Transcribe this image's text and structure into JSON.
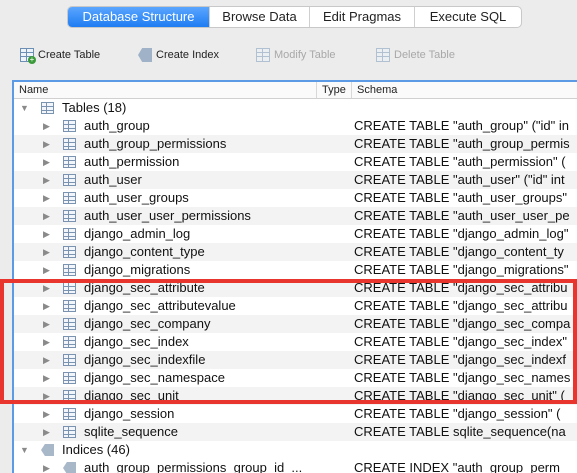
{
  "tabs": [
    {
      "label": "Database Structure",
      "active": true
    },
    {
      "label": "Browse Data",
      "active": false
    },
    {
      "label": "Edit Pragmas",
      "active": false
    },
    {
      "label": "Execute SQL",
      "active": false
    }
  ],
  "toolbar": {
    "create_table": "Create Table",
    "create_index": "Create Index",
    "modify_table": "Modify Table",
    "delete_table": "Delete Table"
  },
  "columns": {
    "name": "Name",
    "type": "Type",
    "schema": "Schema"
  },
  "tables_group": {
    "label": "Tables (18)",
    "expanded": true
  },
  "tables": [
    {
      "name": "auth_group",
      "schema": "CREATE TABLE \"auth_group\" (\"id\" in"
    },
    {
      "name": "auth_group_permissions",
      "schema": "CREATE TABLE \"auth_group_permis"
    },
    {
      "name": "auth_permission",
      "schema": "CREATE TABLE \"auth_permission\" ("
    },
    {
      "name": "auth_user",
      "schema": "CREATE TABLE \"auth_user\" (\"id\" int"
    },
    {
      "name": "auth_user_groups",
      "schema": "CREATE TABLE \"auth_user_groups\""
    },
    {
      "name": "auth_user_user_permissions",
      "schema": "CREATE TABLE \"auth_user_user_pe"
    },
    {
      "name": "django_admin_log",
      "schema": "CREATE TABLE \"django_admin_log\""
    },
    {
      "name": "django_content_type",
      "schema": "CREATE TABLE \"django_content_ty"
    },
    {
      "name": "django_migrations",
      "schema": "CREATE TABLE \"django_migrations\""
    },
    {
      "name": "django_sec_attribute",
      "schema": "CREATE TABLE \"django_sec_attribu"
    },
    {
      "name": "django_sec_attributevalue",
      "schema": "CREATE TABLE \"django_sec_attribu"
    },
    {
      "name": "django_sec_company",
      "schema": "CREATE TABLE \"django_sec_compa"
    },
    {
      "name": "django_sec_index",
      "schema": "CREATE TABLE \"django_sec_index\""
    },
    {
      "name": "django_sec_indexfile",
      "schema": "CREATE TABLE \"django_sec_indexf"
    },
    {
      "name": "django_sec_namespace",
      "schema": "CREATE TABLE \"django_sec_names"
    },
    {
      "name": "django_sec_unit",
      "schema": "CREATE TABLE \"django_sec_unit\" ("
    },
    {
      "name": "django_session",
      "schema": "CREATE TABLE \"django_session\" ("
    },
    {
      "name": "sqlite_sequence",
      "schema": "CREATE TABLE sqlite_sequence(na"
    }
  ],
  "indices_group": {
    "label": "Indices (46)",
    "expanded": true
  },
  "indices": [
    {
      "name": "auth_group_permissions_group_id_...",
      "schema": "CREATE INDEX \"auth_group_perm"
    }
  ],
  "colors": {
    "accent": "#1f7cf2",
    "highlight": "#e8352d"
  }
}
